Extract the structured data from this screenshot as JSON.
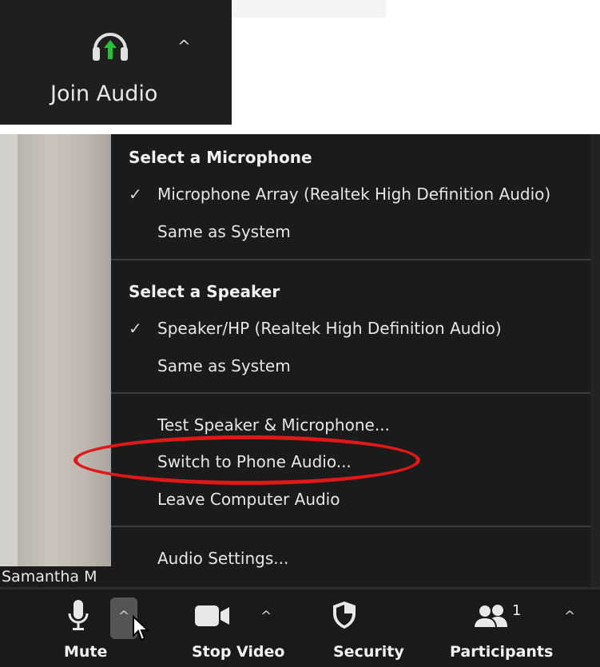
{
  "join_audio": {
    "label": "Join Audio",
    "caret": "^",
    "icon": "headphones-up-arrow-icon",
    "arrow_color": "#27c23c"
  },
  "participant": {
    "name": "Samantha M"
  },
  "audio_menu": {
    "microphone_heading": "Select a Microphone",
    "microphone_options": [
      {
        "label": "Microphone Array (Realtek High Definition Audio)",
        "checked": true
      },
      {
        "label": "Same as System",
        "checked": false
      }
    ],
    "speaker_heading": "Select a Speaker",
    "speaker_options": [
      {
        "label": "Speaker/HP (Realtek High Definition Audio)",
        "checked": true
      },
      {
        "label": "Same as System",
        "checked": false
      }
    ],
    "actions": [
      {
        "label": "Test Speaker & Microphone..."
      },
      {
        "label": "Switch to Phone Audio..."
      },
      {
        "label": "Leave Computer Audio"
      }
    ],
    "settings": {
      "label": "Audio Settings..."
    },
    "check_glyph": "✓",
    "highlight_color": "#e01818"
  },
  "toolbar": {
    "mute": {
      "label": "Mute",
      "icon": "microphone-icon"
    },
    "video": {
      "label": "Stop Video",
      "icon": "video-camera-icon"
    },
    "security": {
      "label": "Security",
      "icon": "shield-icon"
    },
    "participants": {
      "label": "Participants",
      "icon": "participants-icon",
      "count": "1"
    },
    "caret": "^"
  }
}
